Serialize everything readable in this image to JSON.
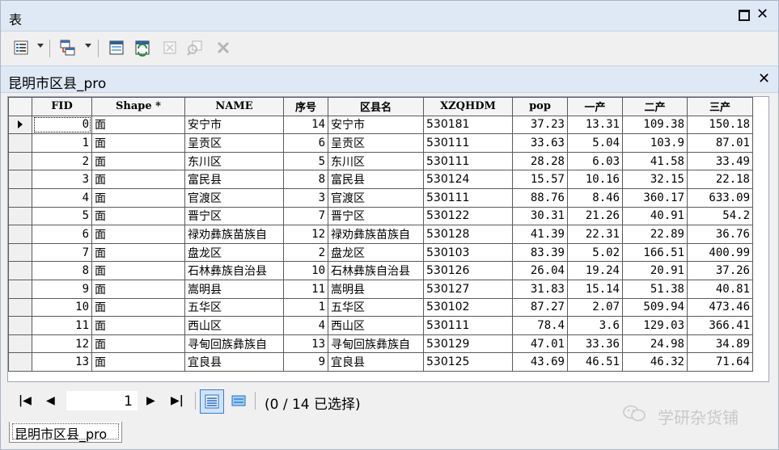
{
  "window": {
    "title": "表"
  },
  "table_tab": {
    "name": "昆明市区县_pro"
  },
  "columns": [
    "FID",
    "Shape *",
    "NAME",
    "序号",
    "区县名",
    "XZQHDM",
    "pop",
    "一产",
    "二产",
    "三产"
  ],
  "rows": [
    [
      "0",
      "面",
      "安宁市",
      "14",
      "安宁市",
      "530181",
      "37.23",
      "13.31",
      "109.38",
      "150.18"
    ],
    [
      "1",
      "面",
      "呈贡区",
      "6",
      "呈贡区",
      "530111",
      "33.63",
      "5.04",
      "103.9",
      "87.01"
    ],
    [
      "2",
      "面",
      "东川区",
      "5",
      "东川区",
      "530111",
      "28.28",
      "6.03",
      "41.58",
      "33.49"
    ],
    [
      "3",
      "面",
      "富民县",
      "8",
      "富民县",
      "530124",
      "15.57",
      "10.16",
      "32.15",
      "22.18"
    ],
    [
      "4",
      "面",
      "官渡区",
      "3",
      "官渡区",
      "530111",
      "88.76",
      "8.46",
      "360.17",
      "633.09"
    ],
    [
      "5",
      "面",
      "晋宁区",
      "7",
      "晋宁区",
      "530122",
      "30.31",
      "21.26",
      "40.91",
      "54.2"
    ],
    [
      "6",
      "面",
      "禄劝彝族苗族自",
      "12",
      "禄劝彝族苗族自",
      "530128",
      "41.39",
      "22.31",
      "22.89",
      "36.76"
    ],
    [
      "7",
      "面",
      "盘龙区",
      "2",
      "盘龙区",
      "530103",
      "83.39",
      "5.02",
      "166.51",
      "400.99"
    ],
    [
      "8",
      "面",
      "石林彝族自治县",
      "10",
      "石林彝族自治县",
      "530126",
      "26.04",
      "19.24",
      "20.91",
      "37.26"
    ],
    [
      "9",
      "面",
      "嵩明县",
      "11",
      "嵩明县",
      "530127",
      "31.83",
      "15.14",
      "51.38",
      "40.81"
    ],
    [
      "10",
      "面",
      "五华区",
      "1",
      "五华区",
      "530102",
      "87.27",
      "2.07",
      "509.94",
      "473.46"
    ],
    [
      "11",
      "面",
      "西山区",
      "4",
      "西山区",
      "530111",
      "78.4",
      "3.6",
      "129.03",
      "366.41"
    ],
    [
      "12",
      "面",
      "寻甸回族彝族自",
      "13",
      "寻甸回族彝族自",
      "530129",
      "47.01",
      "33.36",
      "24.98",
      "34.89"
    ],
    [
      "13",
      "面",
      "宜良县",
      "9",
      "宜良县",
      "530125",
      "43.69",
      "46.51",
      "46.32",
      "71.64"
    ]
  ],
  "navigation": {
    "current_record": "1",
    "selection_info": "(0 / 14 已选择)"
  },
  "bottom_tab": {
    "label": "昆明市区县_pro"
  },
  "watermark": {
    "text": "学研杂货铺"
  }
}
